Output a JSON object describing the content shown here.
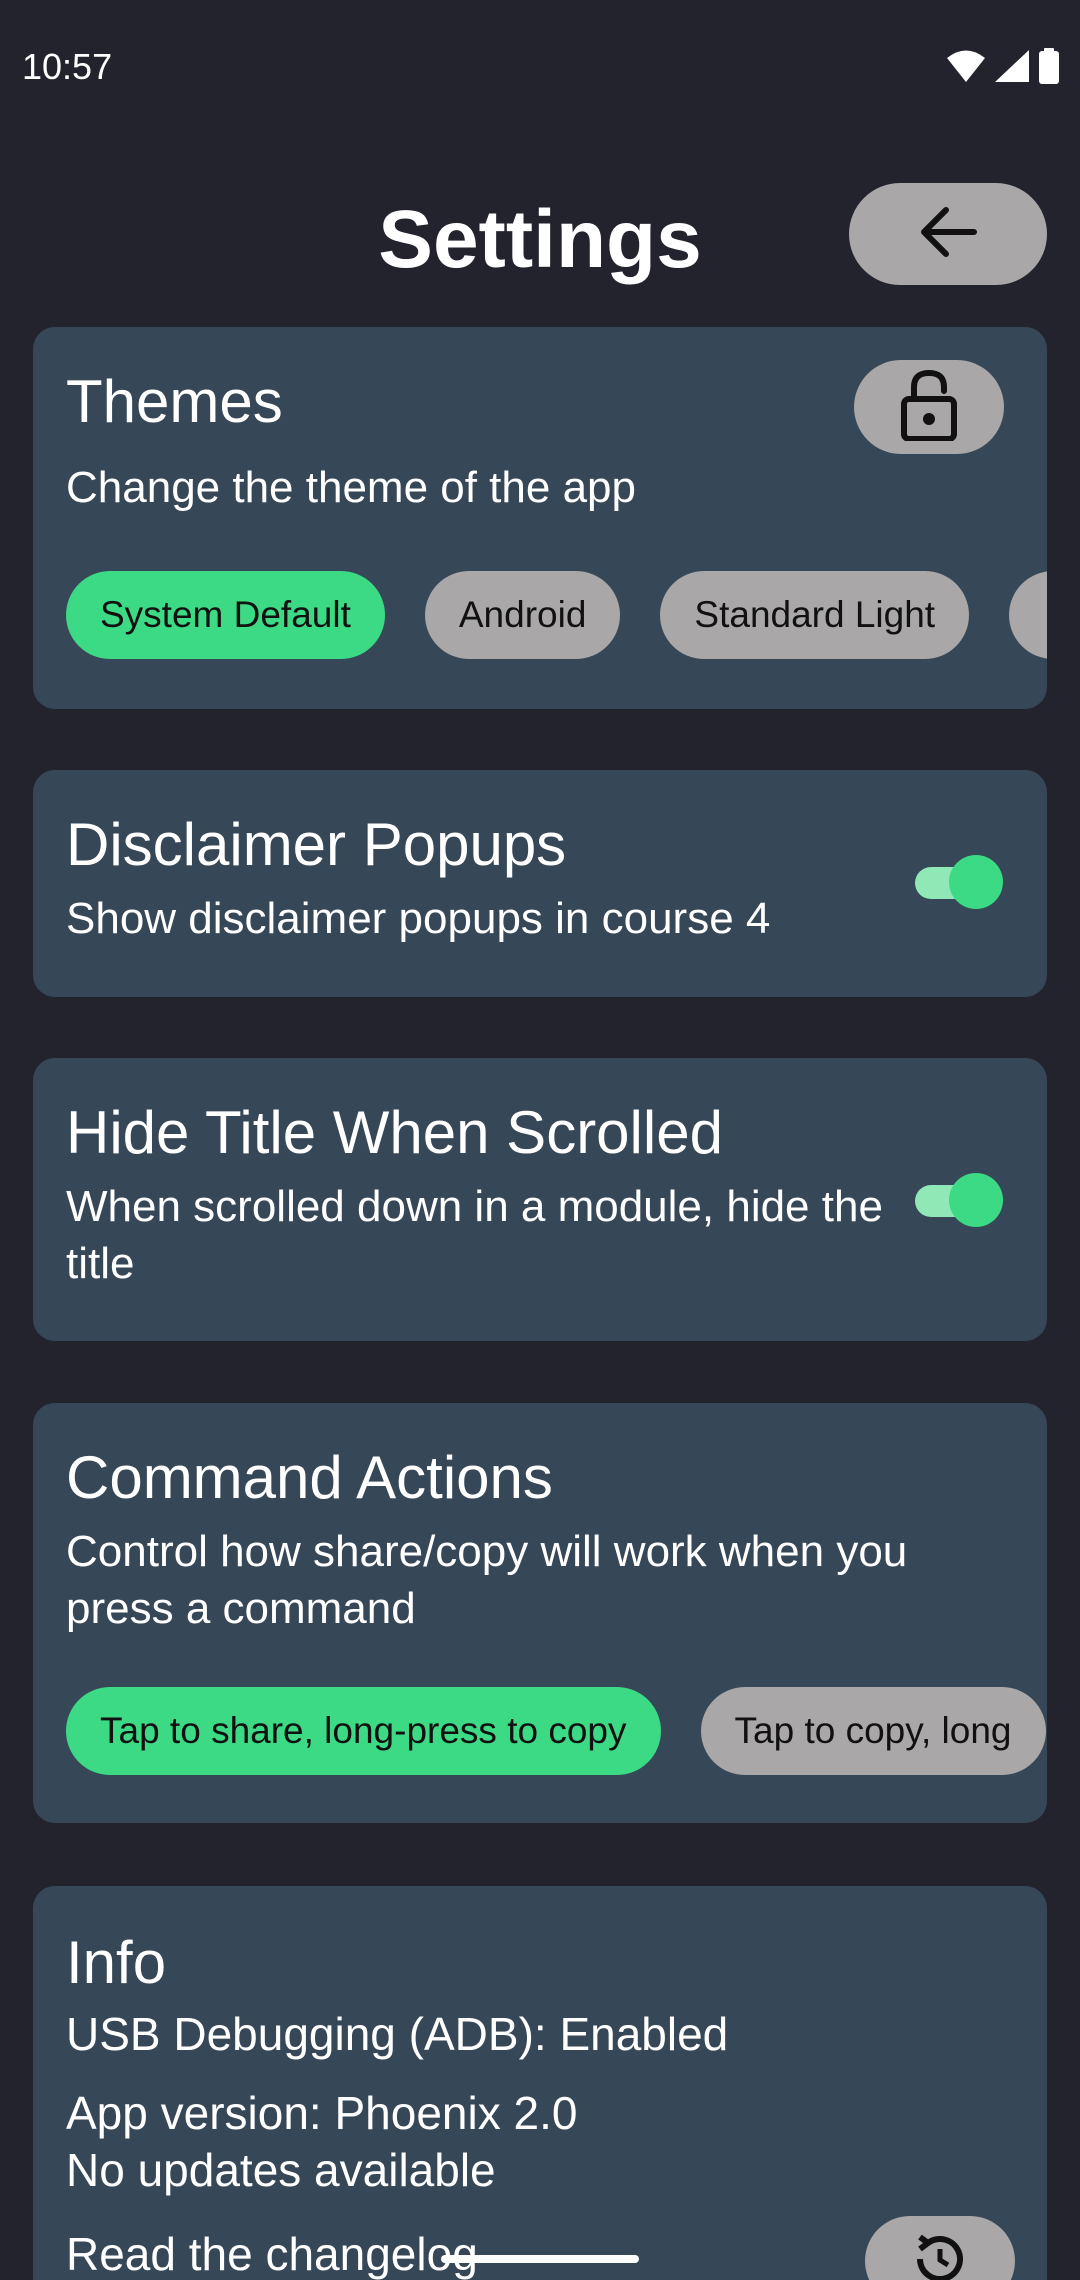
{
  "status_bar": {
    "time": "10:57",
    "icons": [
      "wifi-icon",
      "signal-icon",
      "battery-icon"
    ]
  },
  "header": {
    "title": "Settings",
    "back_icon": "arrow-left-icon"
  },
  "themes": {
    "title": "Themes",
    "description": "Change the theme of the app",
    "lock_icon": "lock-open-icon",
    "chips": [
      {
        "label": "System Default",
        "selected": true
      },
      {
        "label": "Android",
        "selected": false
      },
      {
        "label": "Standard Light",
        "selected": false
      },
      {
        "label": "",
        "selected": false
      }
    ]
  },
  "disclaimer": {
    "title": "Disclaimer Popups",
    "description": "Show disclaimer popups in course 4",
    "enabled": true
  },
  "hide_title": {
    "title": "Hide Title When Scrolled",
    "description": "When scrolled down in a module, hide the title",
    "enabled": true
  },
  "command_actions": {
    "title": "Command Actions",
    "description": "Control how share/copy will work when you press a command",
    "chips": [
      {
        "label": "Tap to share, long-press to copy",
        "selected": true
      },
      {
        "label": "Tap to copy, long",
        "selected": false
      }
    ]
  },
  "info": {
    "title": "Info",
    "adb_status": "USB Debugging (ADB): Enabled",
    "app_version": "App version: Phoenix 2.0",
    "update_status": "No updates available",
    "changelog_link": "Read the changelog",
    "history_icon": "history-icon"
  },
  "colors": {
    "background": "#22232d",
    "card": "#364757",
    "accent_green": "#3cda84",
    "chip_grey": "#a9a7a8"
  }
}
